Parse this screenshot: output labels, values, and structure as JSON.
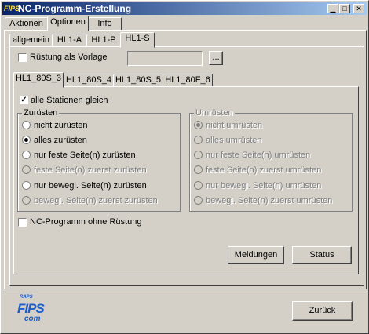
{
  "window": {
    "title": "NC-Programm-Erstellung",
    "icon_text": "FIPS"
  },
  "main_tabs": [
    {
      "label": "Aktionen"
    },
    {
      "label": "Optionen"
    },
    {
      "label": "Info"
    }
  ],
  "sub_tabs": [
    {
      "label": "allgemein"
    },
    {
      "label": "HL1-A"
    },
    {
      "label": "HL1-P"
    },
    {
      "label": "HL1-S"
    }
  ],
  "ruestung_vorlage": {
    "label": "Rüstung als Vorlage",
    "checked": false,
    "value": "",
    "browse_label": "..."
  },
  "station_tabs": [
    {
      "label": "HL1_80S_3"
    },
    {
      "label": "HL1_80S_4"
    },
    {
      "label": "HL1_80S_5"
    },
    {
      "label": "HL1_80F_6"
    }
  ],
  "alle_stationen": {
    "label": "alle Stationen gleich",
    "checked": true
  },
  "zuruesten": {
    "title": "Zurüsten",
    "options": [
      {
        "label": "nicht zurüsten"
      },
      {
        "label": "alles zurüsten"
      },
      {
        "label": "nur feste Seite(n) zurüsten"
      },
      {
        "label": "feste Seite(n) zuerst zurüsten"
      },
      {
        "label": "nur bewegl. Seite(n) zurüsten"
      },
      {
        "label": "bewegl. Seite(n) zuerst zurüsten"
      }
    ]
  },
  "umruesten": {
    "title": "Umrüsten",
    "options": [
      {
        "label": "nicht umrüsten"
      },
      {
        "label": "alles umrüsten"
      },
      {
        "label": "nur feste Seite(n) umrüsten"
      },
      {
        "label": "feste Seite(n) zuerst umrüsten"
      },
      {
        "label": "nur bewegl. Seite(n) umrüsten"
      },
      {
        "label": "bewegl. Seite(n) zuerst umrüsten"
      }
    ]
  },
  "nc_ohne_ruestung": {
    "label": "NC-Programm ohne Rüstung",
    "checked": false
  },
  "buttons": {
    "meldungen": "Meldungen",
    "status": "Status",
    "zurueck": "Zurück"
  },
  "logo": {
    "top": "RAPS",
    "main": "FIPS",
    "sub": "com"
  },
  "colors": {
    "face": "#d4d0c8",
    "title_start": "#0a246a",
    "title_end": "#a6caf0",
    "logo": "#1e5cc8"
  }
}
